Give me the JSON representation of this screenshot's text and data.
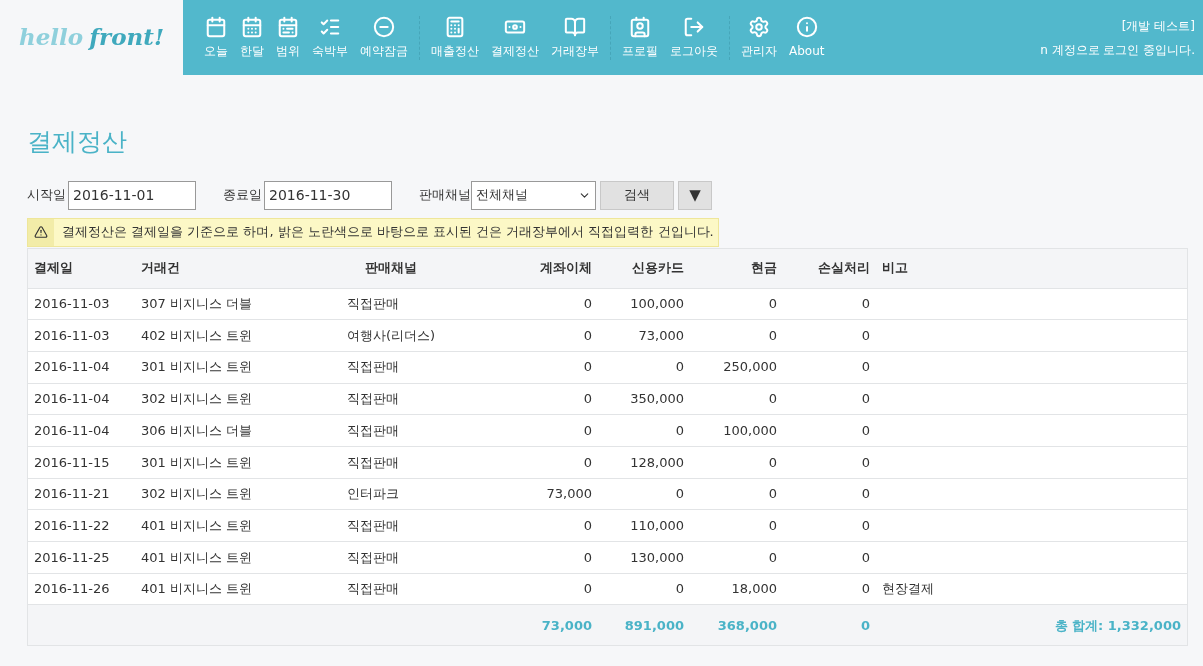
{
  "logo": {
    "first": "hello",
    "second": "front!"
  },
  "nav": [
    [
      "오늘",
      "한달",
      "범위",
      "숙박부",
      "예약잠금"
    ],
    [
      "매출정산",
      "결제정산",
      "거래장부"
    ],
    [
      "프로필",
      "로그아웃"
    ],
    [
      "관리자",
      "About"
    ]
  ],
  "user": {
    "env": "[개발 테스트]",
    "status": "n 계정으로 로그인 중입니다."
  },
  "title": "결제정산",
  "filters": {
    "start_label": "시작일",
    "start": "2016-11-01",
    "end_label": "종료일",
    "end": "2016-11-30",
    "channel_label": "판매채널",
    "channel": "전체채널",
    "search": "검색",
    "toggle": "▼"
  },
  "notice": "결제정산은 결제일을 기준으로 하며, 밝은 노란색으로 바탕으로 표시된 건은 거래장부에서 직접입력한 건입니다.",
  "table": {
    "columns": [
      "결제일",
      "거래건",
      "판매채널",
      "계좌이체",
      "신용카드",
      "현금",
      "손실처리",
      "비고"
    ],
    "rows": [
      [
        "2016-11-03",
        "307 비지니스 더블",
        "직접판매",
        "0",
        "100,000",
        "0",
        "0",
        ""
      ],
      [
        "2016-11-03",
        "402 비지니스 트윈",
        "여행사(리더스)",
        "0",
        "73,000",
        "0",
        "0",
        ""
      ],
      [
        "2016-11-04",
        "301 비지니스 트윈",
        "직접판매",
        "0",
        "0",
        "250,000",
        "0",
        ""
      ],
      [
        "2016-11-04",
        "302 비지니스 트윈",
        "직접판매",
        "0",
        "350,000",
        "0",
        "0",
        ""
      ],
      [
        "2016-11-04",
        "306 비지니스 더블",
        "직접판매",
        "0",
        "0",
        "100,000",
        "0",
        ""
      ],
      [
        "2016-11-15",
        "301 비지니스 트윈",
        "직접판매",
        "0",
        "128,000",
        "0",
        "0",
        ""
      ],
      [
        "2016-11-21",
        "302 비지니스 트윈",
        "인터파크",
        "73,000",
        "0",
        "0",
        "0",
        ""
      ],
      [
        "2016-11-22",
        "401 비지니스 트윈",
        "직접판매",
        "0",
        "110,000",
        "0",
        "0",
        ""
      ],
      [
        "2016-11-25",
        "401 비지니스 트윈",
        "직접판매",
        "0",
        "130,000",
        "0",
        "0",
        ""
      ],
      [
        "2016-11-26",
        "401 비지니스 트윈",
        "직접판매",
        "0",
        "0",
        "18,000",
        "0",
        "현장결제"
      ]
    ],
    "totals": [
      "73,000",
      "891,000",
      "368,000",
      "0"
    ],
    "grand_total": "총 합계: 1,332,000"
  }
}
